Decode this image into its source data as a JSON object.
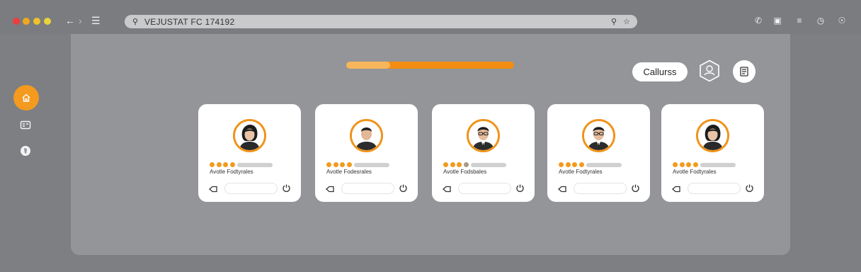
{
  "browser": {
    "address_text": "VEJUSTAT FC 174192",
    "traffic_colors": [
      "#ee3d3d",
      "#f2a81d",
      "#f0c12a",
      "#e8d33a"
    ],
    "nav_icons": [
      "back-arrow-icon",
      "forward-arrow-icon",
      "menu-icon"
    ],
    "right_icons": [
      "phone-icon",
      "clipboard-icon",
      "list-icon",
      "clock-icon",
      "globe-icon"
    ]
  },
  "rail": {
    "items": [
      {
        "icon": "home-icon",
        "active": true
      },
      {
        "icon": "calendar-icon",
        "active": false
      },
      {
        "icon": "shield-icon",
        "active": false
      }
    ],
    "accent": "#f39a1f"
  },
  "header": {
    "progress_fraction": 0.26,
    "button_label": "Callurss",
    "hex_icon": "badge-icon",
    "circle_icon": "document-icon"
  },
  "cards": [
    {
      "label": "Avotle Fodtyrales",
      "rating": 4,
      "avatar": "woman-avatar"
    },
    {
      "label": "Avotle Fodesrales",
      "rating": 4,
      "avatar": "man-avatar"
    },
    {
      "label": "Avotle Fodsbales",
      "rating": 3,
      "avatar": "man-glasses-avatar"
    },
    {
      "label": "Avotle Fodtyrales",
      "rating": 4,
      "avatar": "man-glasses-avatar"
    },
    {
      "label": "Avotle Fodtyrales",
      "rating": 4,
      "avatar": "woman-avatar"
    }
  ]
}
